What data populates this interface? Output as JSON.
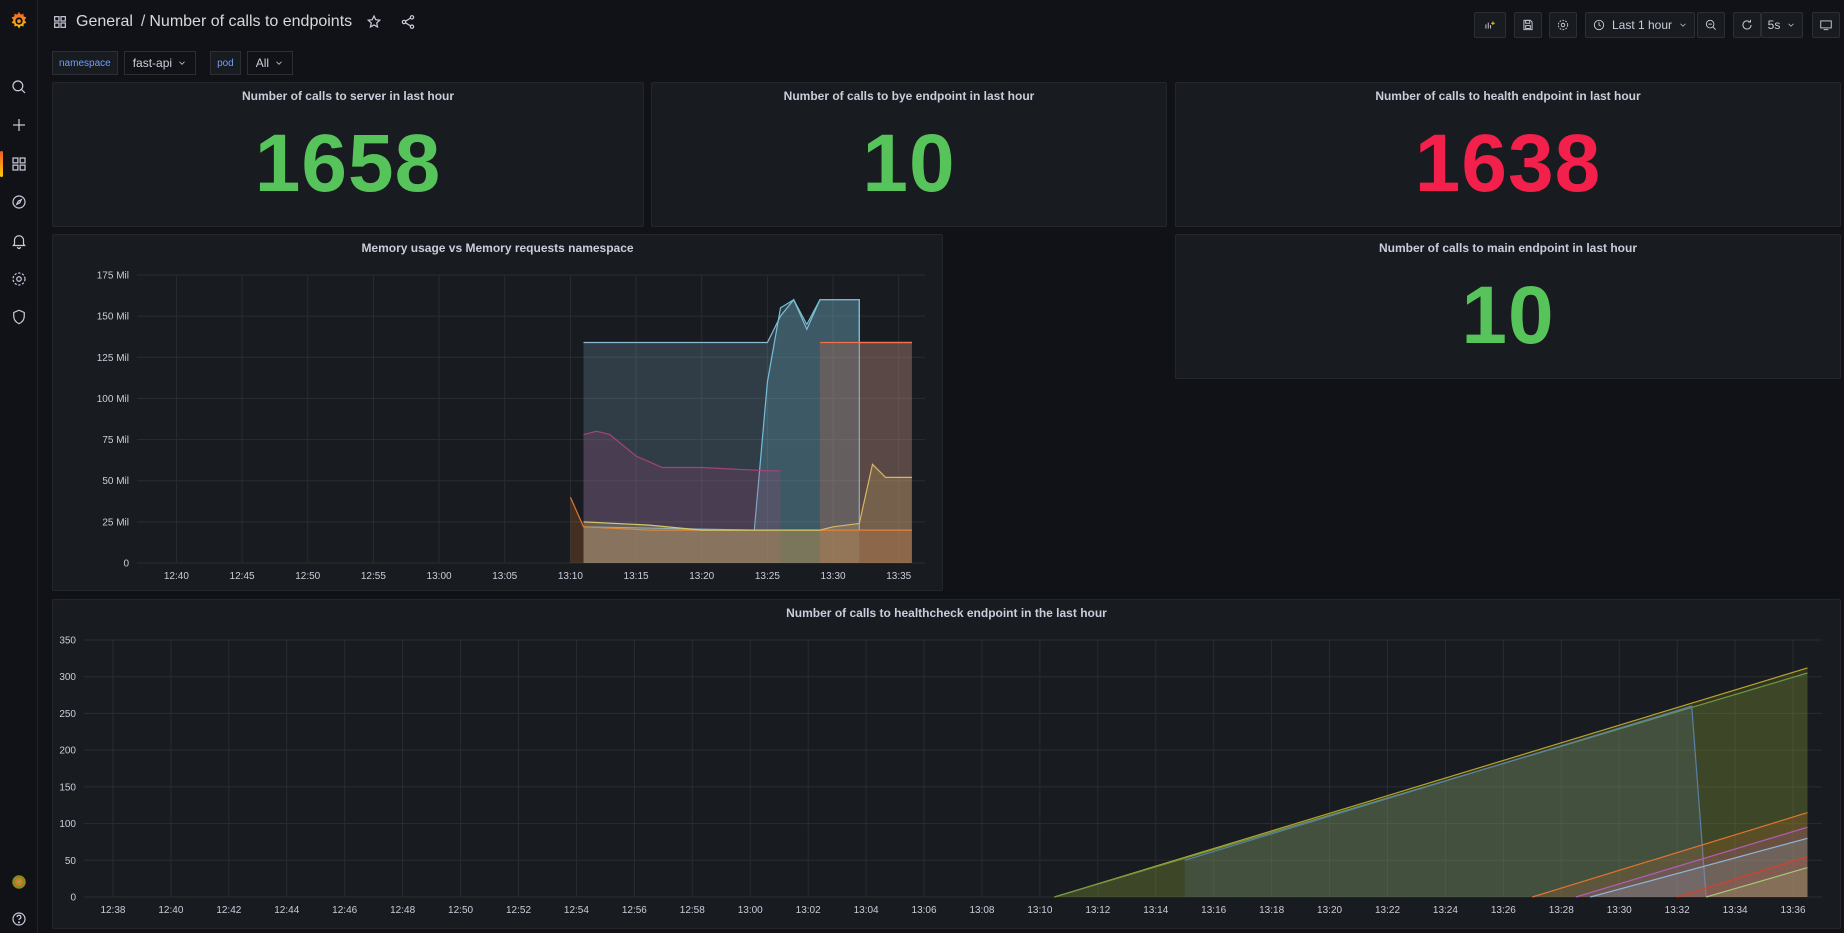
{
  "breadcrumb": {
    "folder": "General",
    "separator": "/",
    "title": "Number of calls to endpoints"
  },
  "toolbar": {
    "time_range": "Last 1 hour",
    "refresh": "5s"
  },
  "variables": [
    {
      "label": "namespace",
      "value": "fast-api"
    },
    {
      "label": "pod",
      "value": "All"
    }
  ],
  "stats": {
    "server": {
      "title": "Number of calls to server in last hour",
      "value": "1658",
      "color": "#56c45a"
    },
    "bye": {
      "title": "Number of calls to bye endpoint in last hour",
      "value": "10",
      "color": "#56c45a"
    },
    "health": {
      "title": "Number of calls to health endpoint in last hour",
      "value": "1638",
      "color": "#f2204a"
    },
    "main": {
      "title": "Number of calls to main endpoint in last hour",
      "value": "10",
      "color": "#56c45a"
    }
  },
  "chart_data": [
    {
      "type": "area",
      "title": "Memory usage vs Memory requests namespace",
      "y_ticks": [
        "0",
        "25 Mil",
        "50 Mil",
        "75 Mil",
        "100 Mil",
        "125 Mil",
        "150 Mil",
        "175 Mil"
      ],
      "ylim": [
        0,
        175
      ],
      "x_ticks": [
        "12:40",
        "12:45",
        "12:50",
        "12:55",
        "13:00",
        "13:05",
        "13:10",
        "13:15",
        "13:20",
        "13:25",
        "13:30",
        "13:35"
      ],
      "xlim_minutes": [
        "12:37",
        "13:37"
      ],
      "series": [
        {
          "color": "#8ab8d6",
          "x": [
            "13:11",
            "13:25",
            "13:25",
            "13:26",
            "13:27",
            "13:28",
            "13:29",
            "13:31",
            "13:32",
            "13:32",
            "13:36"
          ],
          "y": [
            134,
            134,
            134,
            150,
            160,
            142,
            160,
            160,
            160,
            134,
            134
          ]
        },
        {
          "color": "#73bfd6",
          "x": [
            "13:11",
            "13:24",
            "13:25",
            "13:26",
            "13:27",
            "13:28",
            "13:29",
            "13:32",
            "13:32"
          ],
          "y": [
            22,
            20,
            110,
            155,
            160,
            145,
            160,
            160,
            20
          ]
        },
        {
          "color": "#a34478",
          "x": [
            "13:11",
            "13:12",
            "13:13",
            "13:15",
            "13:17",
            "13:20",
            "13:25",
            "13:26"
          ],
          "y": [
            78,
            80,
            78,
            65,
            58,
            58,
            56,
            56
          ]
        },
        {
          "color": "#e0752d",
          "x": [
            "13:10",
            "13:11",
            "13:16",
            "13:20",
            "13:25",
            "13:27",
            "13:29",
            "13:36"
          ],
          "y": [
            40,
            22,
            20,
            20,
            20,
            20,
            20,
            20
          ]
        },
        {
          "color": "#d0ca6a",
          "x": [
            "13:11",
            "13:16",
            "13:20",
            "13:25",
            "13:29",
            "13:30",
            "13:32",
            "13:33",
            "13:34",
            "13:36"
          ],
          "y": [
            25,
            23,
            20,
            20,
            20,
            22,
            24,
            60,
            52,
            52
          ]
        },
        {
          "color": "#f2704a",
          "x": [
            "13:29",
            "13:36"
          ],
          "y": [
            134,
            134
          ]
        }
      ]
    },
    {
      "type": "line",
      "title": "Number of calls to healthcheck endpoint in the last hour",
      "y_ticks": [
        "0",
        "50",
        "100",
        "150",
        "200",
        "250",
        "300",
        "350"
      ],
      "ylim": [
        0,
        350
      ],
      "x_ticks": [
        "12:38",
        "12:40",
        "12:42",
        "12:44",
        "12:46",
        "12:48",
        "12:50",
        "12:52",
        "12:54",
        "12:56",
        "12:58",
        "13:00",
        "13:02",
        "13:04",
        "13:06",
        "13:08",
        "13:10",
        "13:12",
        "13:14",
        "13:16",
        "13:18",
        "13:20",
        "13:22",
        "13:24",
        "13:26",
        "13:28",
        "13:30",
        "13:32",
        "13:34",
        "13:36"
      ],
      "series": [
        {
          "color": "#b5a52e",
          "x": [
            "13:10.5",
            "13:36.5"
          ],
          "y": [
            0,
            312
          ]
        },
        {
          "color": "#6c9a44",
          "x": [
            "13:10.5",
            "13:36.5"
          ],
          "y": [
            0,
            305
          ]
        },
        {
          "color": "#5a7fa8",
          "x": [
            "13:15",
            "13:32.5",
            "13:33"
          ],
          "y": [
            50,
            260,
            0
          ]
        },
        {
          "color": "#e0752d",
          "x": [
            "13:27",
            "13:36.5"
          ],
          "y": [
            0,
            115
          ]
        },
        {
          "color": "#b05fb8",
          "x": [
            "13:28.5",
            "13:36.5"
          ],
          "y": [
            0,
            95
          ]
        },
        {
          "color": "#8ab8d6",
          "x": [
            "13:29",
            "13:36.5"
          ],
          "y": [
            0,
            80
          ]
        },
        {
          "color": "#d0432a",
          "x": [
            "13:32",
            "13:36.5"
          ],
          "y": [
            0,
            55
          ]
        },
        {
          "color": "#a0c878",
          "x": [
            "13:33",
            "13:36.5"
          ],
          "y": [
            0,
            40
          ]
        }
      ]
    }
  ]
}
